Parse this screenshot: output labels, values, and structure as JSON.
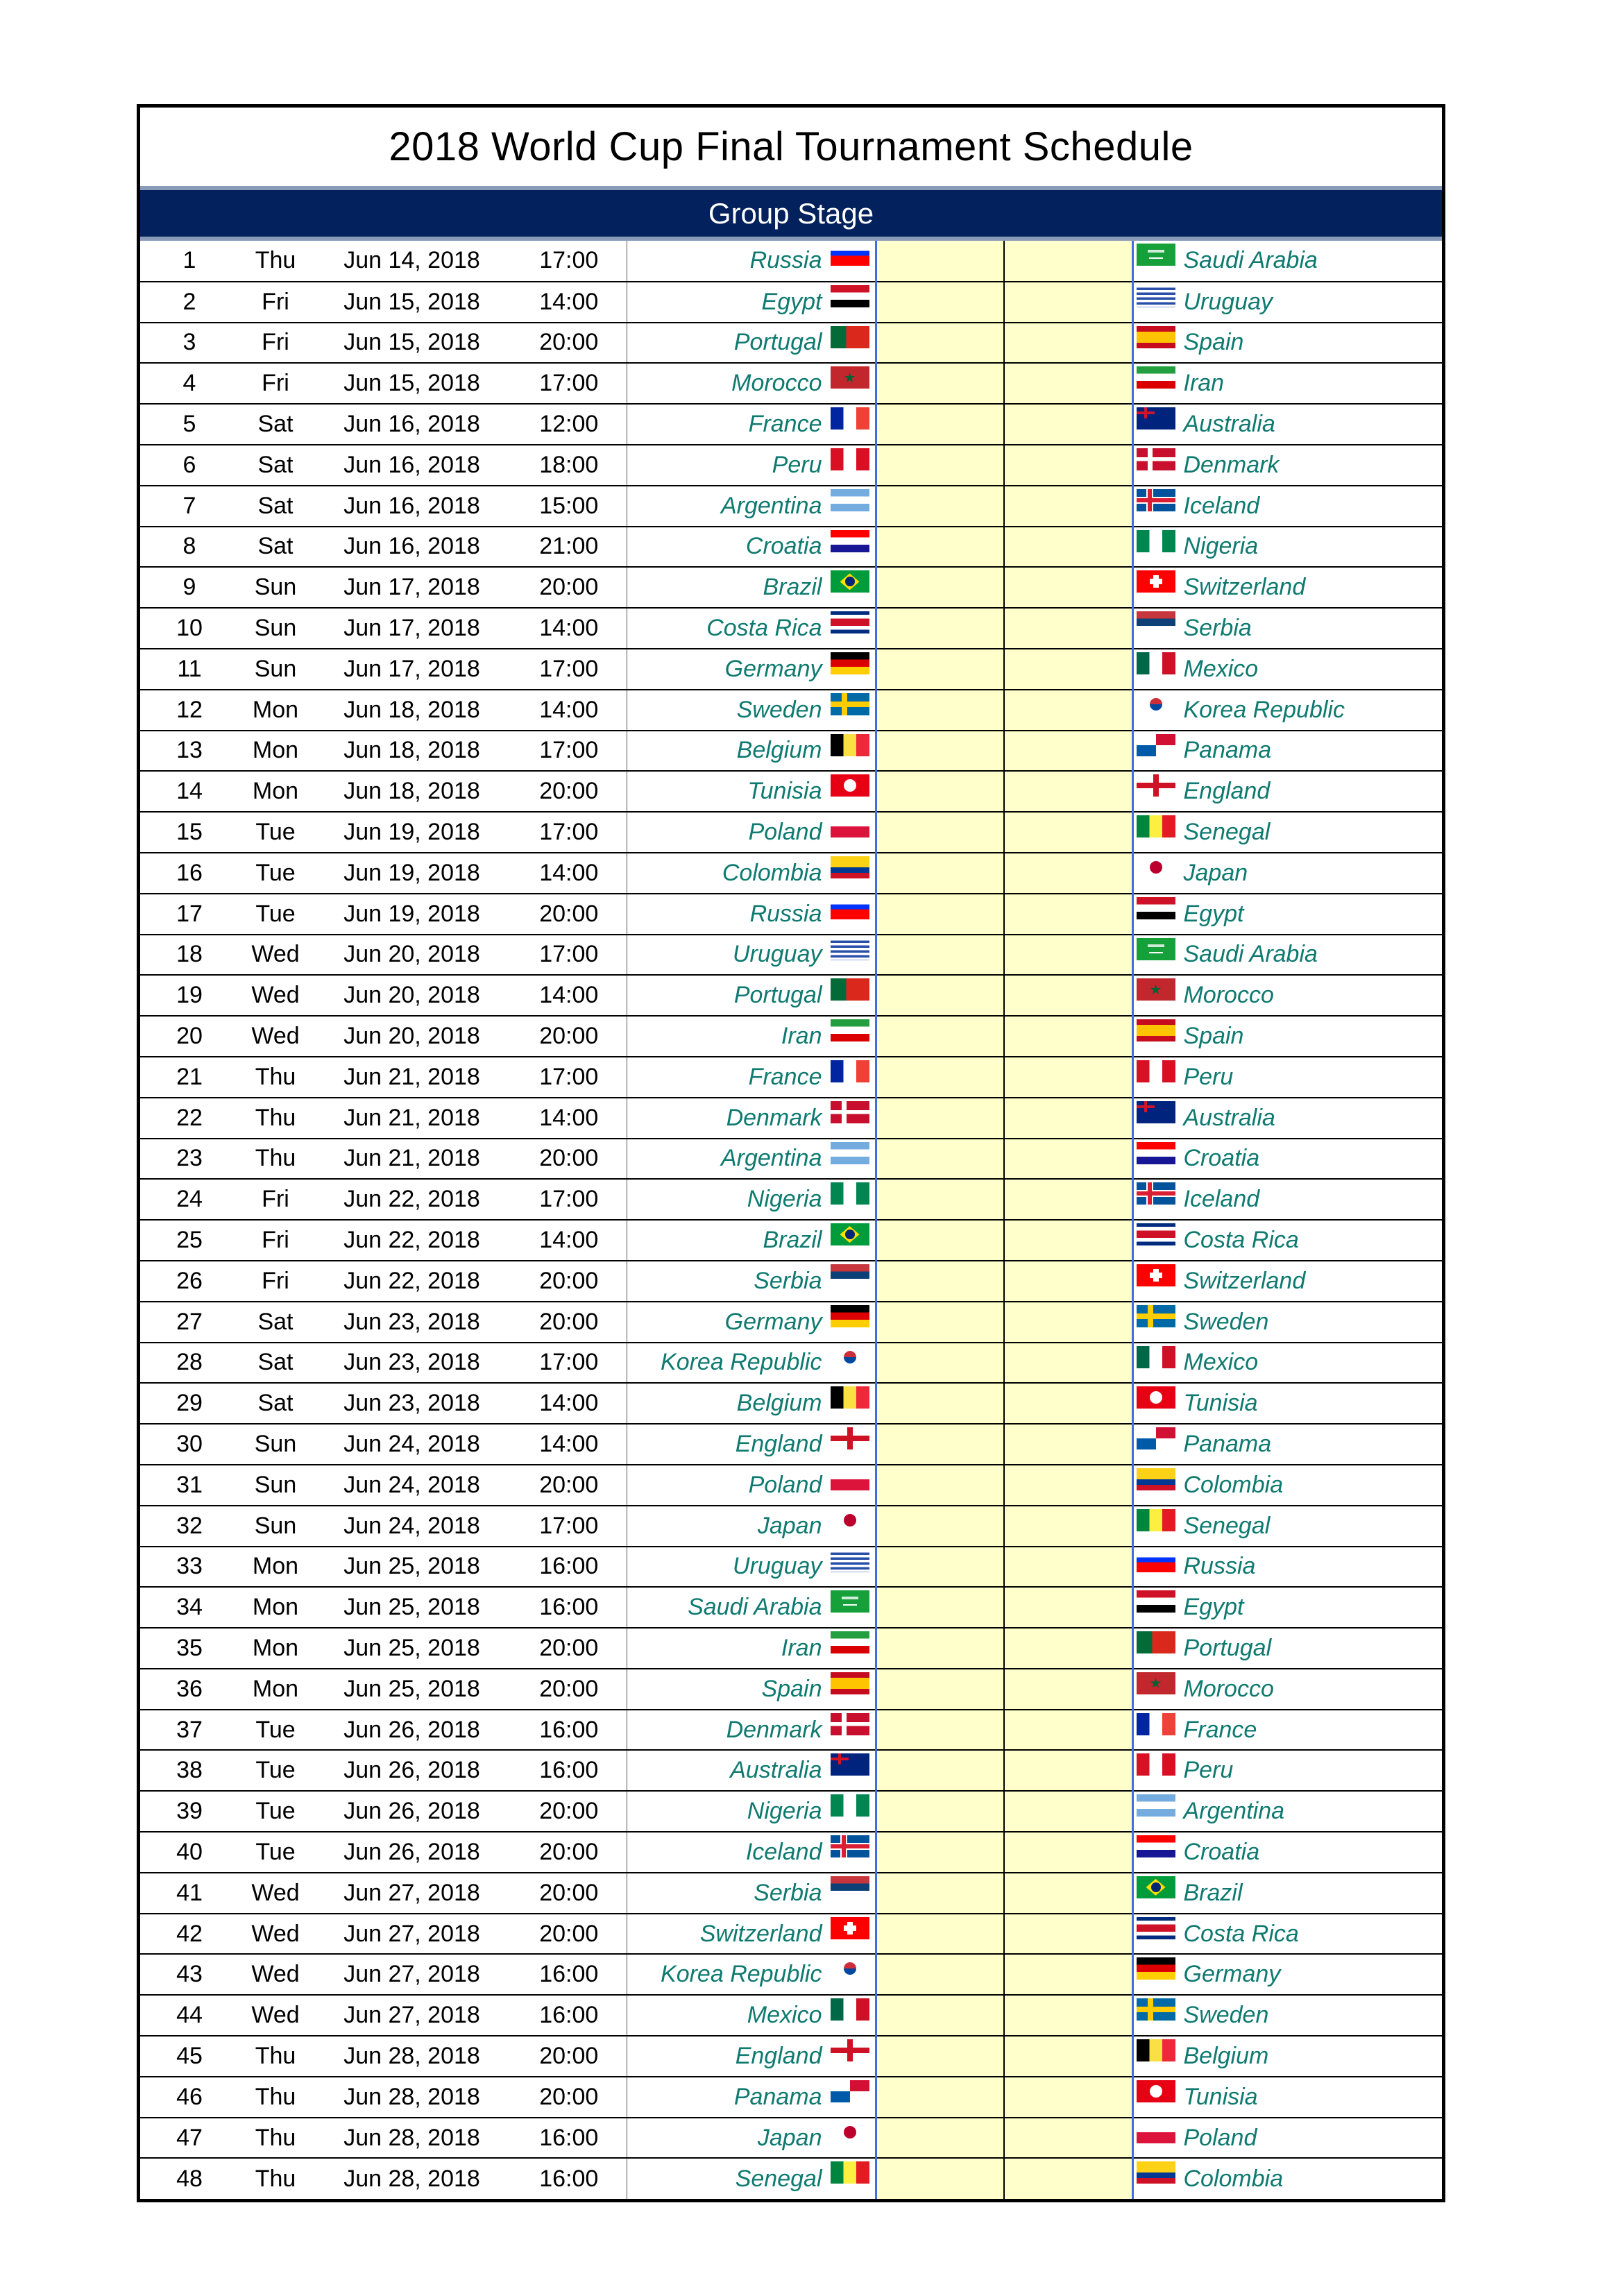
{
  "title": "2018 World Cup Final Tournament Schedule",
  "stage": "Group Stage",
  "colors": {
    "header_bg": "#03215c",
    "team_text": "#0f7a70",
    "score_bg": "#ffffcc",
    "divider_blue": "#3e6ee0"
  },
  "matches": [
    {
      "no": "1",
      "day": "Thu",
      "date": "Jun 14, 2018",
      "time": "17:00",
      "home": "Russia",
      "away": "Saudi Arabia"
    },
    {
      "no": "2",
      "day": "Fri",
      "date": "Jun 15, 2018",
      "time": "14:00",
      "home": "Egypt",
      "away": "Uruguay"
    },
    {
      "no": "3",
      "day": "Fri",
      "date": "Jun 15, 2018",
      "time": "20:00",
      "home": "Portugal",
      "away": "Spain"
    },
    {
      "no": "4",
      "day": "Fri",
      "date": "Jun 15, 2018",
      "time": "17:00",
      "home": "Morocco",
      "away": "Iran"
    },
    {
      "no": "5",
      "day": "Sat",
      "date": "Jun 16, 2018",
      "time": "12:00",
      "home": "France",
      "away": "Australia"
    },
    {
      "no": "6",
      "day": "Sat",
      "date": "Jun 16, 2018",
      "time": "18:00",
      "home": "Peru",
      "away": "Denmark"
    },
    {
      "no": "7",
      "day": "Sat",
      "date": "Jun 16, 2018",
      "time": "15:00",
      "home": "Argentina",
      "away": "Iceland"
    },
    {
      "no": "8",
      "day": "Sat",
      "date": "Jun 16, 2018",
      "time": "21:00",
      "home": "Croatia",
      "away": "Nigeria"
    },
    {
      "no": "9",
      "day": "Sun",
      "date": "Jun 17, 2018",
      "time": "20:00",
      "home": "Brazil",
      "away": "Switzerland"
    },
    {
      "no": "10",
      "day": "Sun",
      "date": "Jun 17, 2018",
      "time": "14:00",
      "home": "Costa Rica",
      "away": "Serbia"
    },
    {
      "no": "11",
      "day": "Sun",
      "date": "Jun 17, 2018",
      "time": "17:00",
      "home": "Germany",
      "away": "Mexico"
    },
    {
      "no": "12",
      "day": "Mon",
      "date": "Jun 18, 2018",
      "time": "14:00",
      "home": "Sweden",
      "away": "Korea Republic"
    },
    {
      "no": "13",
      "day": "Mon",
      "date": "Jun 18, 2018",
      "time": "17:00",
      "home": "Belgium",
      "away": "Panama"
    },
    {
      "no": "14",
      "day": "Mon",
      "date": "Jun 18, 2018",
      "time": "20:00",
      "home": "Tunisia",
      "away": "England"
    },
    {
      "no": "15",
      "day": "Tue",
      "date": "Jun 19, 2018",
      "time": "17:00",
      "home": "Poland",
      "away": "Senegal"
    },
    {
      "no": "16",
      "day": "Tue",
      "date": "Jun 19, 2018",
      "time": "14:00",
      "home": "Colombia",
      "away": "Japan"
    },
    {
      "no": "17",
      "day": "Tue",
      "date": "Jun 19, 2018",
      "time": "20:00",
      "home": "Russia",
      "away": "Egypt"
    },
    {
      "no": "18",
      "day": "Wed",
      "date": "Jun 20, 2018",
      "time": "17:00",
      "home": "Uruguay",
      "away": "Saudi Arabia"
    },
    {
      "no": "19",
      "day": "Wed",
      "date": "Jun 20, 2018",
      "time": "14:00",
      "home": "Portugal",
      "away": "Morocco"
    },
    {
      "no": "20",
      "day": "Wed",
      "date": "Jun 20, 2018",
      "time": "20:00",
      "home": "Iran",
      "away": "Spain"
    },
    {
      "no": "21",
      "day": "Thu",
      "date": "Jun 21, 2018",
      "time": "17:00",
      "home": "France",
      "away": "Peru"
    },
    {
      "no": "22",
      "day": "Thu",
      "date": "Jun 21, 2018",
      "time": "14:00",
      "home": "Denmark",
      "away": "Australia"
    },
    {
      "no": "23",
      "day": "Thu",
      "date": "Jun 21, 2018",
      "time": "20:00",
      "home": "Argentina",
      "away": "Croatia"
    },
    {
      "no": "24",
      "day": "Fri",
      "date": "Jun 22, 2018",
      "time": "17:00",
      "home": "Nigeria",
      "away": "Iceland"
    },
    {
      "no": "25",
      "day": "Fri",
      "date": "Jun 22, 2018",
      "time": "14:00",
      "home": "Brazil",
      "away": "Costa Rica"
    },
    {
      "no": "26",
      "day": "Fri",
      "date": "Jun 22, 2018",
      "time": "20:00",
      "home": "Serbia",
      "away": "Switzerland"
    },
    {
      "no": "27",
      "day": "Sat",
      "date": "Jun 23, 2018",
      "time": "20:00",
      "home": "Germany",
      "away": "Sweden"
    },
    {
      "no": "28",
      "day": "Sat",
      "date": "Jun 23, 2018",
      "time": "17:00",
      "home": "Korea Republic",
      "away": "Mexico"
    },
    {
      "no": "29",
      "day": "Sat",
      "date": "Jun 23, 2018",
      "time": "14:00",
      "home": "Belgium",
      "away": "Tunisia"
    },
    {
      "no": "30",
      "day": "Sun",
      "date": "Jun 24, 2018",
      "time": "14:00",
      "home": "England",
      "away": "Panama"
    },
    {
      "no": "31",
      "day": "Sun",
      "date": "Jun 24, 2018",
      "time": "20:00",
      "home": "Poland",
      "away": "Colombia"
    },
    {
      "no": "32",
      "day": "Sun",
      "date": "Jun 24, 2018",
      "time": "17:00",
      "home": "Japan",
      "away": "Senegal"
    },
    {
      "no": "33",
      "day": "Mon",
      "date": "Jun 25, 2018",
      "time": "16:00",
      "home": "Uruguay",
      "away": "Russia"
    },
    {
      "no": "34",
      "day": "Mon",
      "date": "Jun 25, 2018",
      "time": "16:00",
      "home": "Saudi Arabia",
      "away": "Egypt"
    },
    {
      "no": "35",
      "day": "Mon",
      "date": "Jun 25, 2018",
      "time": "20:00",
      "home": "Iran",
      "away": "Portugal"
    },
    {
      "no": "36",
      "day": "Mon",
      "date": "Jun 25, 2018",
      "time": "20:00",
      "home": "Spain",
      "away": "Morocco"
    },
    {
      "no": "37",
      "day": "Tue",
      "date": "Jun 26, 2018",
      "time": "16:00",
      "home": "Denmark",
      "away": "France"
    },
    {
      "no": "38",
      "day": "Tue",
      "date": "Jun 26, 2018",
      "time": "16:00",
      "home": "Australia",
      "away": "Peru"
    },
    {
      "no": "39",
      "day": "Tue",
      "date": "Jun 26, 2018",
      "time": "20:00",
      "home": "Nigeria",
      "away": "Argentina"
    },
    {
      "no": "40",
      "day": "Tue",
      "date": "Jun 26, 2018",
      "time": "20:00",
      "home": "Iceland",
      "away": "Croatia"
    },
    {
      "no": "41",
      "day": "Wed",
      "date": "Jun 27, 2018",
      "time": "20:00",
      "home": "Serbia",
      "away": "Brazil"
    },
    {
      "no": "42",
      "day": "Wed",
      "date": "Jun 27, 2018",
      "time": "20:00",
      "home": "Switzerland",
      "away": "Costa Rica"
    },
    {
      "no": "43",
      "day": "Wed",
      "date": "Jun 27, 2018",
      "time": "16:00",
      "home": "Korea Republic",
      "away": "Germany"
    },
    {
      "no": "44",
      "day": "Wed",
      "date": "Jun 27, 2018",
      "time": "16:00",
      "home": "Mexico",
      "away": "Sweden"
    },
    {
      "no": "45",
      "day": "Thu",
      "date": "Jun 28, 2018",
      "time": "20:00",
      "home": "England",
      "away": "Belgium"
    },
    {
      "no": "46",
      "day": "Thu",
      "date": "Jun 28, 2018",
      "time": "20:00",
      "home": "Panama",
      "away": "Tunisia"
    },
    {
      "no": "47",
      "day": "Thu",
      "date": "Jun 28, 2018",
      "time": "16:00",
      "home": "Japan",
      "away": "Poland"
    },
    {
      "no": "48",
      "day": "Thu",
      "date": "Jun 28, 2018",
      "time": "16:00",
      "home": "Senegal",
      "away": "Colombia"
    }
  ]
}
